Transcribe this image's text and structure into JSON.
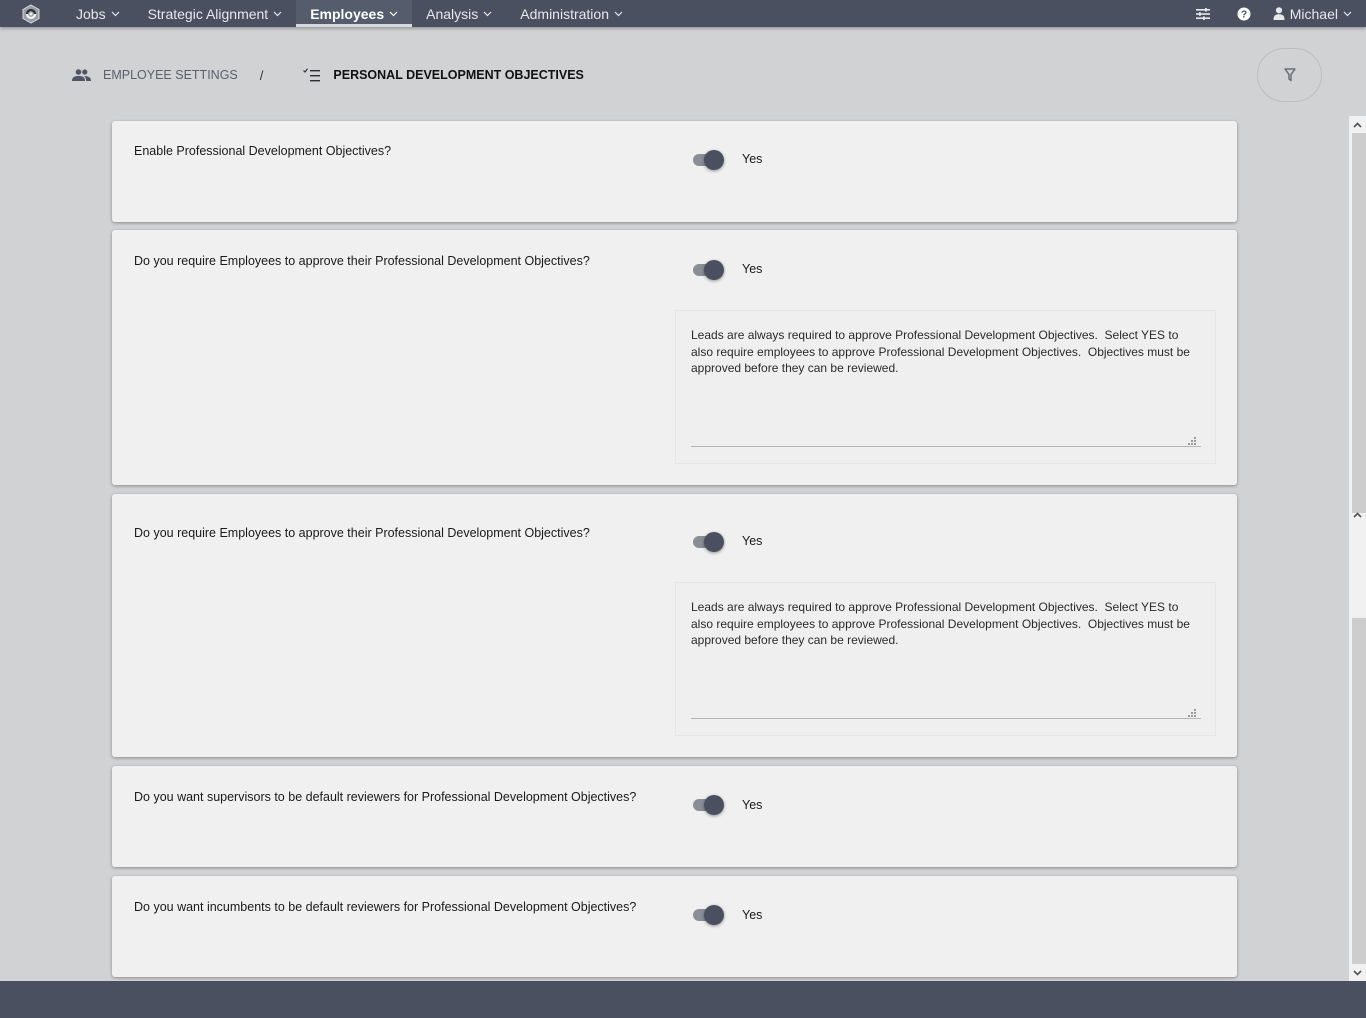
{
  "nav": {
    "items": [
      {
        "label": "Jobs",
        "active": false
      },
      {
        "label": "Strategic Alignment",
        "active": false
      },
      {
        "label": "Employees",
        "active": true
      },
      {
        "label": "Analysis",
        "active": false
      },
      {
        "label": "Administration",
        "active": false
      }
    ],
    "user": "Michael",
    "icons": {
      "settings": "sliders-icon",
      "help": "help-circle-icon",
      "user": "user-icon"
    }
  },
  "breadcrumb": {
    "parent": "EMPLOYEE SETTINGS",
    "separator": "/",
    "current": "PERSONAL DEVELOPMENT OBJECTIVES"
  },
  "settings": [
    {
      "question": "Enable Professional Development Objectives?",
      "value": "Yes",
      "enabled": true
    },
    {
      "question": "Do you require Employees to approve their Professional Development Objectives?",
      "value": "Yes",
      "enabled": true,
      "note": "Leads are always required to approve Professional Development Objectives.  Select YES to also require employees to approve Professional Development Objectives.  Objectives must be approved before they can be reviewed."
    },
    {
      "question": "Do you require Employees to approve their Professional Development Objectives?",
      "value": "Yes",
      "enabled": true,
      "note": "Leads are always required to approve Professional Development Objectives.  Select YES to also require employees to approve Professional Development Objectives.  Objectives must be approved before they can be reviewed."
    },
    {
      "question": "Do you want supervisors to be default reviewers for Professional Development Objectives?",
      "value": "Yes",
      "enabled": true
    },
    {
      "question": "Do you want incumbents to be default reviewers for Professional Development Objectives?",
      "value": "Yes",
      "enabled": true
    }
  ],
  "colors": {
    "nav_bg": "#4a5060",
    "page_bg": "#d1d2d4",
    "card_bg": "#f0f0f0",
    "toggle_thumb": "#4a5060"
  }
}
